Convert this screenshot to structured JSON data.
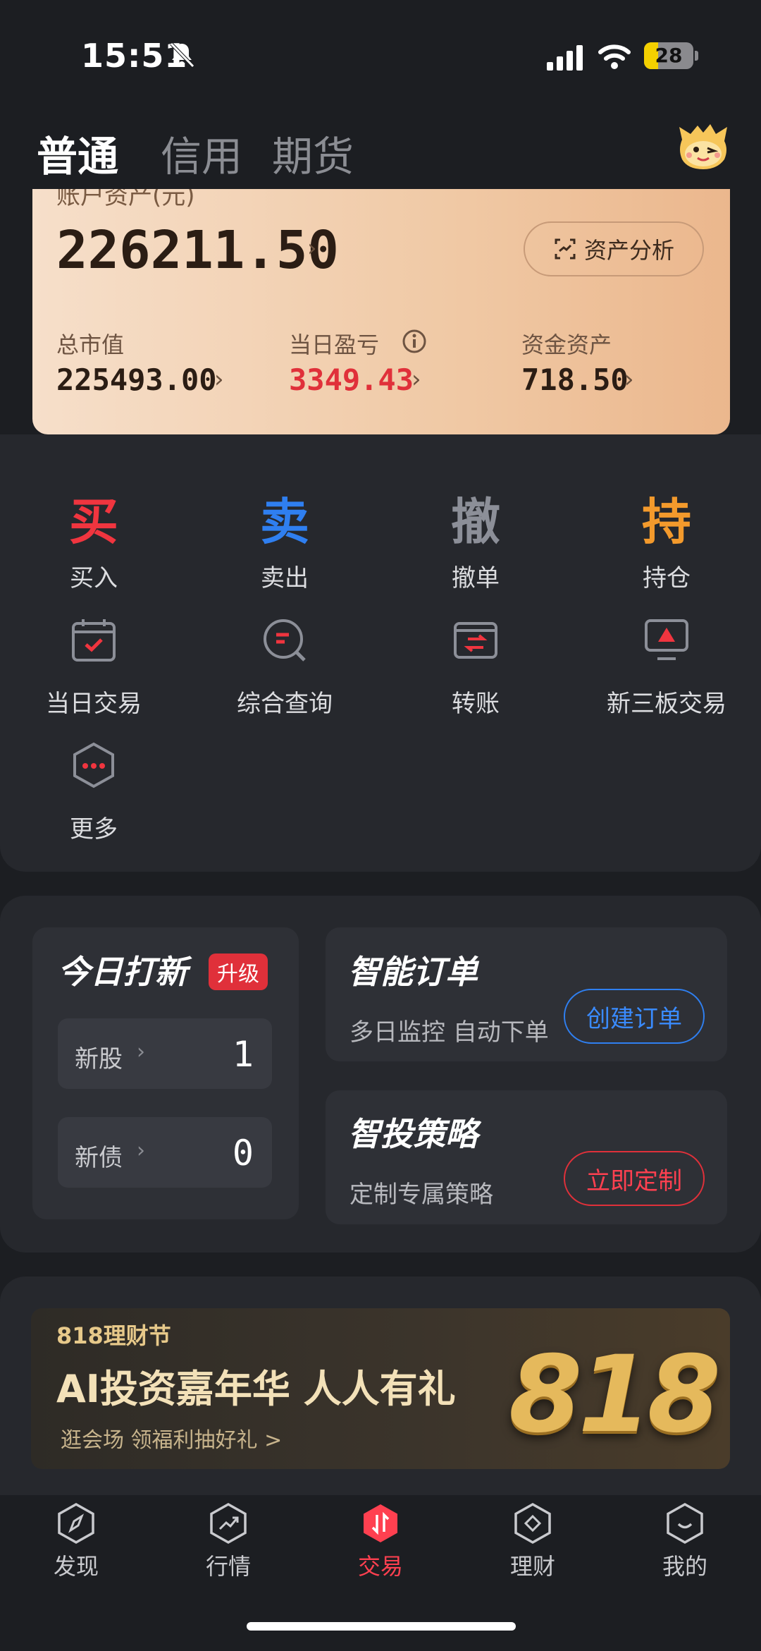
{
  "status_bar": {
    "time": "15:51",
    "battery": "28",
    "battery_fraction": 0.28
  },
  "account_tabs": [
    {
      "label": "普通",
      "active": true
    },
    {
      "label": "信用",
      "active": false
    },
    {
      "label": "期货",
      "active": false
    }
  ],
  "asset_card": {
    "label": "账户资产(元)",
    "total": "226211.50",
    "analysis_button": "资产分析",
    "metrics": [
      {
        "label": "总市值",
        "value": "225493.00"
      },
      {
        "label": "当日盈亏",
        "value": "3349.43"
      },
      {
        "label": "资金资产",
        "value": "718.50"
      }
    ]
  },
  "trade_actions": [
    {
      "char": "买",
      "label": "买入",
      "color": "#f0353f"
    },
    {
      "char": "卖",
      "label": "卖出",
      "color": "#2f7ff0"
    },
    {
      "char": "撤",
      "label": "撤单",
      "color": "#8c8f98"
    },
    {
      "char": "持",
      "label": "持仓",
      "color": "#f39a2c"
    }
  ],
  "tools": [
    {
      "label": "当日交易",
      "icon": "calendar-check-icon"
    },
    {
      "label": "综合查询",
      "icon": "search-query-icon"
    },
    {
      "label": "转账",
      "icon": "transfer-icon"
    },
    {
      "label": "新三板交易",
      "icon": "monitor-icon"
    },
    {
      "label": "更多",
      "icon": "more-icon"
    }
  ],
  "ipo": {
    "title": "今日打新",
    "badge": "升级",
    "rows": [
      {
        "label": "新股",
        "count": "1"
      },
      {
        "label": "新债",
        "count": "0"
      }
    ]
  },
  "smart_order": {
    "title": "智能订单",
    "subtitle": "多日监控 自动下单",
    "button": "创建订单",
    "button_color": "#2f7ff0"
  },
  "smart_strategy": {
    "title": "智投策略",
    "subtitle": "定制专属策略",
    "button": "立即定制",
    "button_color": "#e0303a"
  },
  "banner": {
    "tag": "818理财节",
    "title": "AI投资嘉年华 人人有礼",
    "subtitle": "逛会场 领福利抽好礼 >",
    "big_number": "818"
  },
  "bottom_nav": [
    {
      "label": "发现",
      "icon": "compass-icon",
      "active": false
    },
    {
      "label": "行情",
      "icon": "trend-icon",
      "active": false
    },
    {
      "label": "交易",
      "icon": "trade-icon",
      "active": true
    },
    {
      "label": "理财",
      "icon": "wealth-icon",
      "active": false
    },
    {
      "label": "我的",
      "icon": "profile-icon",
      "active": false
    }
  ],
  "colors": {
    "accent_red": "#e0303a",
    "accent_blue": "#2f7ff0",
    "background": "#1c1e22",
    "panel": "#26282d"
  }
}
